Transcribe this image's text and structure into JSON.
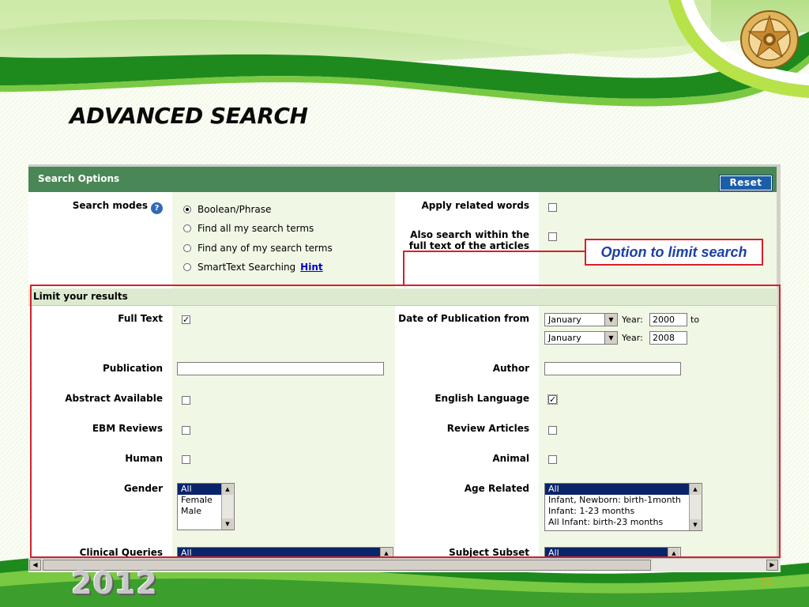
{
  "slide": {
    "title": "ADVANCED SEARCH",
    "footer_year": "2012",
    "page_number": "21",
    "callout": "Option to limit search",
    "colors": {
      "green_dark": "#1e8a1e",
      "green_light": "#9bd42a",
      "highlight_red": "#d6202a",
      "callout_text": "#1b3fa8"
    }
  },
  "search_options": {
    "header": "Search Options",
    "reset_label": "Reset",
    "search_modes_label": "Search modes",
    "help_icon": "?",
    "modes": [
      {
        "label": "Boolean/Phrase",
        "selected": true
      },
      {
        "label": "Find all my search terms",
        "selected": false
      },
      {
        "label": "Find any of my search terms",
        "selected": false
      },
      {
        "label": "SmartText Searching",
        "selected": false
      }
    ],
    "hint_label": "Hint",
    "apply_related_words_label": "Apply related words",
    "apply_related_words_checked": false,
    "full_text_search_label_1": "Also search within the",
    "full_text_search_label_2": "full text of the articles",
    "full_text_search_checked": false
  },
  "limits": {
    "header": "Limit your results",
    "full_text_label": "Full Text",
    "full_text_checked": true,
    "date_label": "Date of Publication from",
    "date_from_month": "January",
    "date_from_year_label": "Year:",
    "date_from_year": "2000",
    "date_to_label": "to",
    "date_to_month": "January",
    "date_to_year_label": "Year:",
    "date_to_year": "2008",
    "publication_label": "Publication",
    "publication_value": "",
    "author_label": "Author",
    "author_value": "",
    "abstract_label": "Abstract Available",
    "abstract_checked": false,
    "english_label": "English Language",
    "english_checked": true,
    "ebm_label": "EBM Reviews",
    "ebm_checked": false,
    "review_label": "Review Articles",
    "review_checked": false,
    "human_label": "Human",
    "human_checked": false,
    "animal_label": "Animal",
    "animal_checked": false,
    "gender_label": "Gender",
    "gender_options": [
      "All",
      "Female",
      "Male"
    ],
    "gender_selected": "All",
    "age_label": "Age Related",
    "age_options": [
      "All",
      "Infant, Newborn: birth-1month",
      "Infant: 1-23 months",
      "All Infant: birth-23 months"
    ],
    "age_selected": "All",
    "clinical_label": "Clinical Queries",
    "clinical_value": "All",
    "subject_label": "Subject Subset",
    "subject_value": "All"
  },
  "icons": {
    "radio_on": "radio-selected-icon",
    "checkbox": "checkbox-icon",
    "dropdown": "chevron-down-icon",
    "emblem": "university-emblem-icon"
  }
}
